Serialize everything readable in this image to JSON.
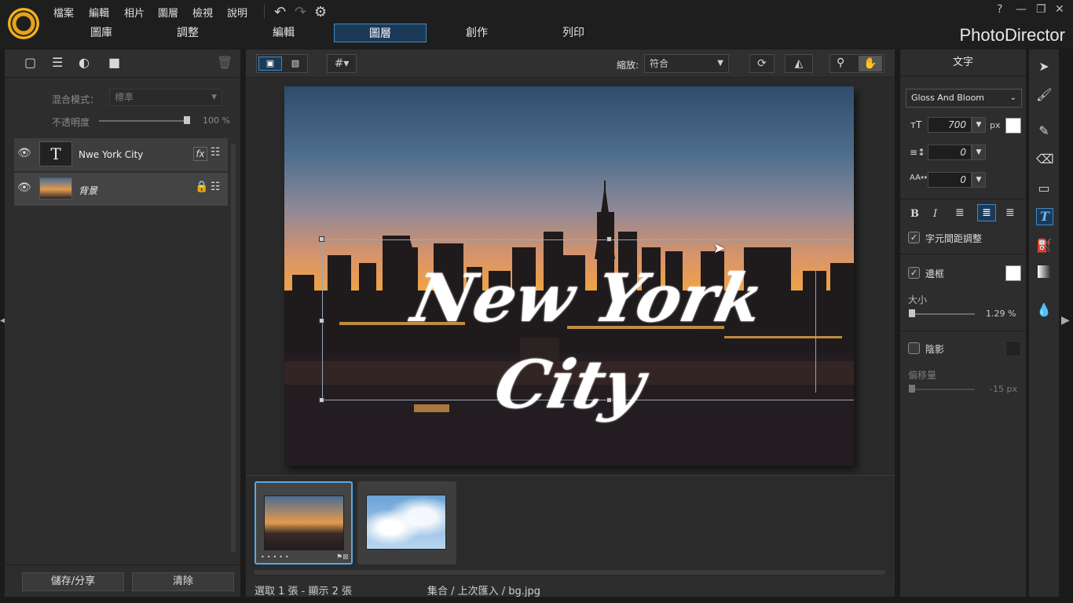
{
  "menu": [
    "檔案",
    "編輯",
    "相片",
    "圖層",
    "檢視",
    "說明"
  ],
  "tabs": [
    "圖庫",
    "調整",
    "編輯",
    "圖層",
    "創作",
    "列印"
  ],
  "active_tab": "圖層",
  "brand": "PhotoDirector",
  "window_controls": {
    "help": "?",
    "minimize": "—",
    "restore": "❐",
    "close": "✕"
  },
  "layers_panel": {
    "blend_label": "混合模式：",
    "blend_value": "標準",
    "opacity_label": "不透明度",
    "opacity_value": "100 %",
    "opacity_fraction": 1.0,
    "layers": [
      {
        "name": "Nwe York City",
        "type": "text",
        "fx": "fx"
      },
      {
        "name": "背景",
        "type": "image"
      }
    ],
    "save_button": "儲存/分享",
    "clear_button": "清除"
  },
  "canvas_toolbar": {
    "zoom_label": "縮放:",
    "zoom_value": "符合"
  },
  "canvas_text": "New York City",
  "status": {
    "selection": "選取 1 張 - 顯示 2 張",
    "path": "集合 / 上次匯入 / bg.jpg"
  },
  "text_panel": {
    "title": "文字",
    "font": "Gloss And Bloom",
    "size_value": "700",
    "size_unit": "px",
    "line_spacing": "0",
    "char_spacing": "0",
    "bold": "B",
    "italic": "I",
    "kerning_label": "字元間距調整",
    "kerning_checked": true,
    "border_label": "邊框",
    "border_checked": true,
    "size_label": "大小",
    "border_size": "1.29 %",
    "border_size_fraction": 0.02,
    "shadow_label": "陰影",
    "shadow_checked": false,
    "offset_label": "偏移量",
    "offset_value": "-15 px"
  },
  "colors": {
    "accent": "#3f88c9",
    "text_color": "#ffffff",
    "border_color": "#ffffff"
  }
}
